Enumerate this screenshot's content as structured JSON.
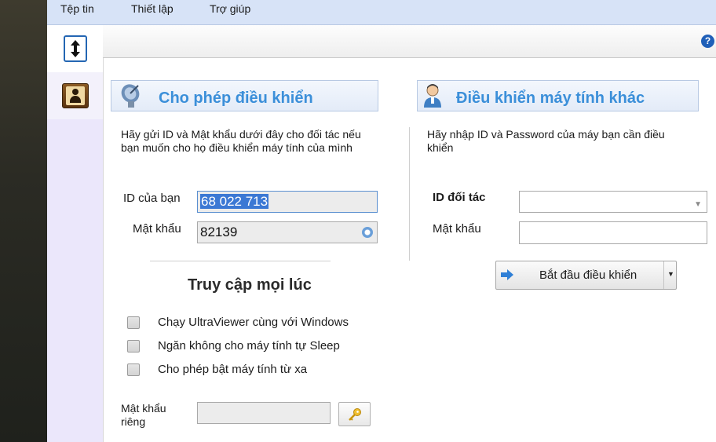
{
  "menubar": {
    "items": [
      "Tệp tin",
      "Thiết lập",
      "Trợ giúp"
    ]
  },
  "sidebar": {
    "items": [
      {
        "icon": "connect-arrows-icon"
      },
      {
        "icon": "address-book-icon"
      }
    ]
  },
  "toolbar": {
    "help_label": "?"
  },
  "allow_control": {
    "title": "Cho phép điều khiển",
    "description": "Hãy gửi ID và Mật khẩu dưới đây cho đối tác nếu bạn muốn cho họ điều khiển máy tính của mình",
    "id_label": "ID của bạn",
    "id_value": "68 022 713",
    "password_label": "Mật khẩu",
    "password_value": "82139"
  },
  "control_remote": {
    "title": "Điều khiển máy tính khác",
    "description": "Hãy nhập ID và Password của máy bạn cần điều khiển",
    "partner_id_label": "ID đối tác",
    "partner_id_value": "",
    "password_label": "Mật khẩu",
    "password_value": "",
    "start_button": "Bắt đầu điều khiển"
  },
  "unattended": {
    "title": "Truy cập mọi lúc",
    "options": [
      {
        "label": "Chạy UltraViewer cùng với Windows",
        "checked": false
      },
      {
        "label": "Ngăn không cho máy tính tự Sleep",
        "checked": false
      },
      {
        "label": "Cho phép bật máy tính từ xa",
        "checked": false
      }
    ],
    "private_password_label": "Mật khẩu riêng",
    "private_password_value": ""
  },
  "colors": {
    "accent": "#3b8fd9",
    "menubar": "#d7e3f7",
    "sidebar": "#ebe7fb",
    "selection": "#3b78d4"
  }
}
